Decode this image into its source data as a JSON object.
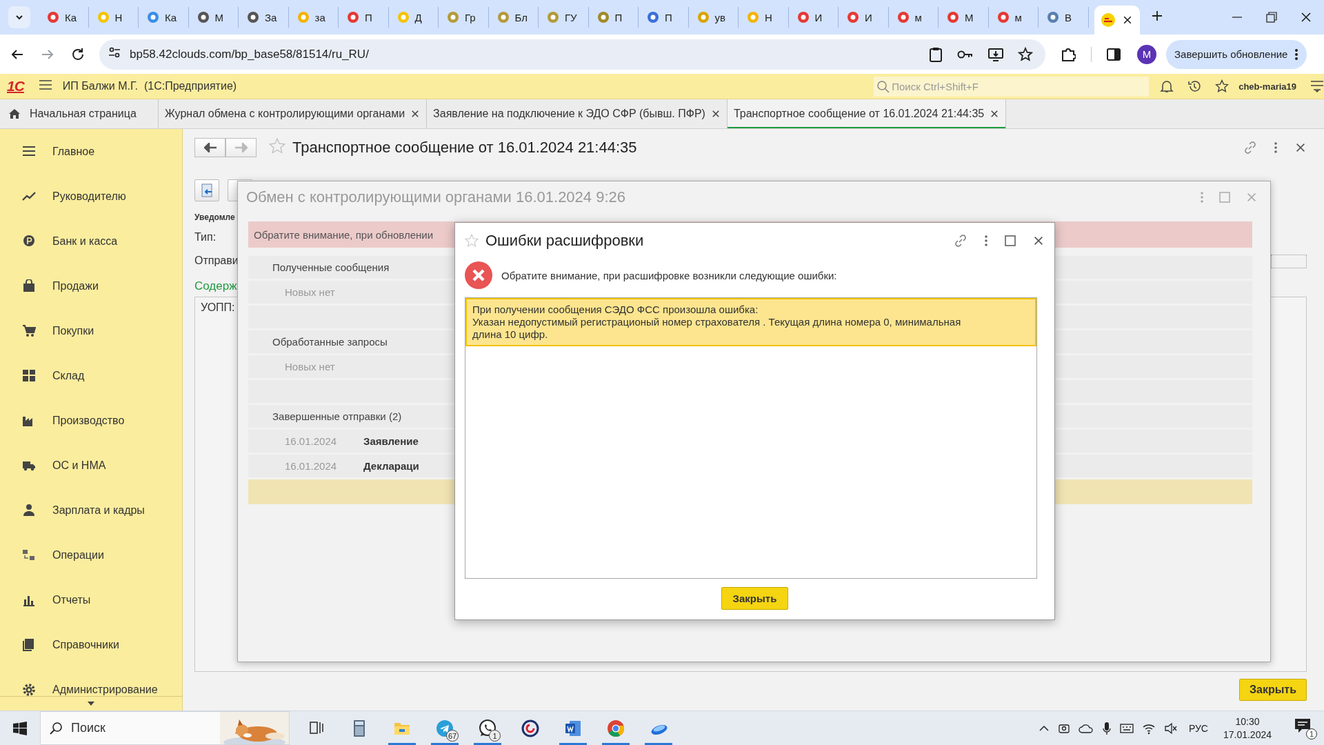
{
  "browser": {
    "tabs": [
      {
        "title": "Ка",
        "selected": false
      },
      {
        "title": "Н",
        "selected": false
      },
      {
        "title": "Ка",
        "selected": false
      },
      {
        "title": "М",
        "selected": false
      },
      {
        "title": "За",
        "selected": false
      },
      {
        "title": "за",
        "selected": false
      },
      {
        "title": "П",
        "selected": false
      },
      {
        "title": "Д",
        "selected": false
      },
      {
        "title": "Гр",
        "selected": false
      },
      {
        "title": "Бл",
        "selected": false
      },
      {
        "title": "ГУ",
        "selected": false
      },
      {
        "title": "П",
        "selected": false
      },
      {
        "title": "П",
        "selected": false
      },
      {
        "title": "ув",
        "selected": false
      },
      {
        "title": "Н",
        "selected": false
      },
      {
        "title": "И",
        "selected": false
      },
      {
        "title": "И",
        "selected": false
      },
      {
        "title": "м",
        "selected": false
      },
      {
        "title": "М",
        "selected": false
      },
      {
        "title": "м",
        "selected": false
      },
      {
        "title": "В",
        "selected": false
      },
      {
        "selected": true
      }
    ],
    "address": "bp58.42clouds.com/bp_base58/81514/ru_RU/",
    "profile_initial": "M",
    "update_button": "Завершить обновление"
  },
  "app": {
    "logo": "1С",
    "title": "ИП Балжи М.Г.  (1С:Предприятие)",
    "search": {
      "placeholder": "Поиск Ctrl+Shift+F"
    },
    "user": "cheb-maria19",
    "tabs": [
      {
        "label": "Начальная страница",
        "kind": "home",
        "selected": false
      },
      {
        "label": "Журнал обмена с контролирующими органами",
        "kind": "closable",
        "selected": false
      },
      {
        "label": "Заявление на подключение к ЭДО СФР (бывш. ПФР)",
        "kind": "closable",
        "selected": false
      },
      {
        "label": "Транспортное сообщение от 16.01.2024 21:44:35",
        "kind": "closable",
        "selected": true
      }
    ]
  },
  "sidebar": {
    "items": [
      {
        "label": "Главное"
      },
      {
        "label": "Руководителю"
      },
      {
        "label": "Банк и касса"
      },
      {
        "label": "Продажи"
      },
      {
        "label": "Покупки"
      },
      {
        "label": "Склад"
      },
      {
        "label": "Производство"
      },
      {
        "label": "ОС и НМА"
      },
      {
        "label": "Зарплата и кадры"
      },
      {
        "label": "Операции"
      },
      {
        "label": "Отчеты"
      },
      {
        "label": "Справочники"
      },
      {
        "label": "Администрирование"
      }
    ]
  },
  "document": {
    "title": "Транспортное сообщение от 16.01.2024 21:44:35",
    "notice_label": "Уведомле",
    "type_label": "Тип:",
    "sender_label": "Отправи",
    "content_heading": "Содерж",
    "content_text": "УОПП:",
    "close_button": "Закрыть"
  },
  "exchange_dialog": {
    "title": "Обмен с контролирующими органами 16.01.2024 9:26",
    "warning": "Обратите внимание, при обновлении",
    "rows": [
      {
        "kind": "section",
        "text": "Полученные сообщения"
      },
      {
        "kind": "empty",
        "text": "Новых нет"
      },
      {
        "kind": "blank"
      },
      {
        "kind": "section",
        "text": "Обработанные запросы"
      },
      {
        "kind": "empty",
        "text": "Новых нет"
      },
      {
        "kind": "blank"
      },
      {
        "kind": "section",
        "text": "Завершенные отправки (2)"
      },
      {
        "kind": "item",
        "date": "16.01.2024",
        "text": "Заявление"
      },
      {
        "kind": "item",
        "date": "16.01.2024",
        "text": "Деклараци"
      },
      {
        "kind": "highlight"
      }
    ]
  },
  "error_dialog": {
    "title": "Ошибки расшифровки",
    "intro": "Обратите внимание, при расшифровке возникли следующие ошибки:",
    "errors": [
      {
        "lines": [
          "При получении сообщения СЭДО ФСС произошла ошибка:",
          "Указан недопустимый регистрационый номер страхователя . Текущая длина номера 0, минимальная длина 10 цифр."
        ],
        "selected": true
      }
    ],
    "close_button": "Закрыть"
  },
  "taskbar": {
    "search_placeholder": "Поиск",
    "apps": [
      {
        "kind": "taskview",
        "running": false
      },
      {
        "kind": "calculator",
        "running": false
      },
      {
        "kind": "files",
        "running": true
      },
      {
        "kind": "telegram",
        "running": true,
        "badge": "67"
      },
      {
        "kind": "whatsapp",
        "running": true,
        "badge": "1"
      },
      {
        "kind": "c-app",
        "running": false
      },
      {
        "kind": "word",
        "running": true
      },
      {
        "kind": "chrome",
        "running": true
      },
      {
        "kind": "cloud",
        "running": true
      }
    ],
    "language": "РУС",
    "time": "10:30",
    "date": "17.01.2024",
    "notifications": "1"
  }
}
